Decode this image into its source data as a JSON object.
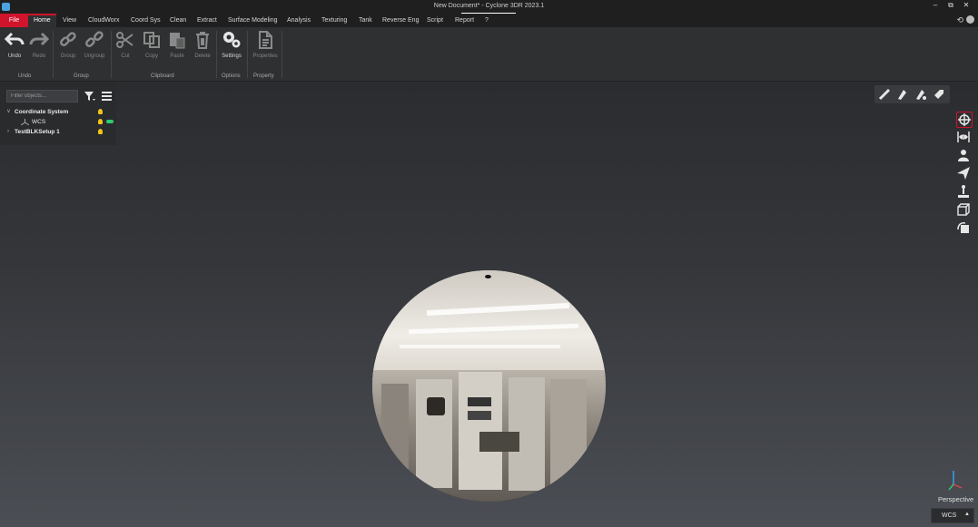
{
  "window": {
    "title": "New Document* - Cyclone 3DR 2023.1",
    "controls": [
      "–",
      "⧉",
      "✕"
    ]
  },
  "tabs": [
    {
      "label": "File"
    },
    {
      "label": "Home"
    },
    {
      "label": "View"
    },
    {
      "label": "CloudWorx"
    },
    {
      "label": "Coord Sys"
    },
    {
      "label": "Clean"
    },
    {
      "label": "Extract"
    },
    {
      "label": "Surface Modeling"
    },
    {
      "label": "Analysis"
    },
    {
      "label": "Texturing"
    },
    {
      "label": "Tank"
    },
    {
      "label": "Reverse Eng"
    },
    {
      "label": "Script"
    },
    {
      "label": "Report"
    },
    {
      "label": "?"
    }
  ],
  "ribbon": {
    "buttons": [
      {
        "label": "Undo",
        "icon": "undo-icon"
      },
      {
        "label": "Redo",
        "icon": "redo-icon"
      },
      {
        "label": "Group",
        "icon": "link-icon"
      },
      {
        "label": "Ungroup",
        "icon": "unlink-icon"
      },
      {
        "label": "Cut",
        "icon": "scissors-icon"
      },
      {
        "label": "Copy",
        "icon": "copy-icon"
      },
      {
        "label": "Paste",
        "icon": "paste-icon"
      },
      {
        "label": "Delete",
        "icon": "trash-icon"
      },
      {
        "label": "Settings",
        "icon": "gear-icon"
      },
      {
        "label": "Properties",
        "icon": "document-icon"
      }
    ],
    "groups": [
      "Undo",
      "Group",
      "Clipboard",
      "Options",
      "Property"
    ]
  },
  "panel": {
    "filter_placeholder": "Filter objects...",
    "tree": [
      {
        "label": "Coordinate System",
        "expanded": true
      },
      {
        "label": "WCS",
        "child": true
      },
      {
        "label": "TestBLKSetup 1",
        "expanded": false
      }
    ]
  },
  "viewport": {
    "projection": "Perspective",
    "coord_system": "WCS"
  },
  "colors": {
    "accent": "#d0142b",
    "bulb": "#f0c419",
    "toggle_on": "#2ecc71"
  }
}
